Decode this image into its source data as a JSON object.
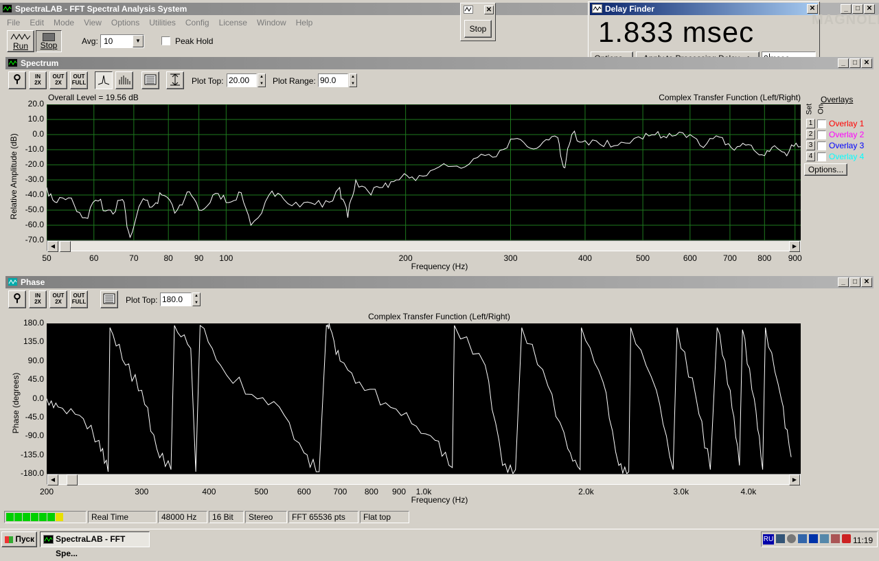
{
  "app": {
    "title": "SpectraLAB - FFT Spectral Analysis System",
    "menu": [
      "File",
      "Edit",
      "Mode",
      "View",
      "Options",
      "Utilities",
      "Config",
      "License",
      "Window",
      "Help"
    ],
    "run_label": "Run",
    "stop_label": "Stop",
    "avg_label": "Avg:",
    "avg_value": "10",
    "peak_hold_label": "Peak Hold"
  },
  "stop_popup": {
    "stop_label": "Stop"
  },
  "delay_finder": {
    "title": "Delay Finder",
    "value": "1.833 msec",
    "options_label": "Options...",
    "apply_label": "Apply to Processing Delay -->",
    "input_value": "0",
    "unit": "msec",
    "watermark": "MAGNOLIA"
  },
  "spectrum": {
    "title": "Spectrum",
    "plot_top_label": "Plot Top:",
    "plot_top_value": "20.00",
    "plot_range_label": "Plot Range:",
    "plot_range_value": "90.0",
    "overall_level": "Overall Level = 19.56 dB",
    "caption": "Complex Transfer Function (Left/Right)",
    "ylabel": "Relative Amplitude (dB)",
    "xlabel": "Frequency (Hz)",
    "yticks": [
      "20.0",
      "10.0",
      "0.0",
      "-10.0",
      "-20.0",
      "-30.0",
      "-40.0",
      "-50.0",
      "-60.0",
      "-70.0"
    ],
    "xticks": [
      "50",
      "60",
      "70",
      "80",
      "90",
      "100",
      "200",
      "300",
      "400",
      "500",
      "600",
      "700",
      "800",
      "900"
    ],
    "overlays": {
      "header": "Overlays",
      "set_label": "Set",
      "on_label": "On",
      "items": [
        {
          "num": "1",
          "label": "Overlay 1",
          "color": "#ff0000"
        },
        {
          "num": "2",
          "label": "Overlay 2",
          "color": "#ff00ff"
        },
        {
          "num": "3",
          "label": "Overlay 3",
          "color": "#0000ff"
        },
        {
          "num": "4",
          "label": "Overlay 4",
          "color": "#00ffff"
        }
      ],
      "options_label": "Options..."
    }
  },
  "phase": {
    "title": "Phase",
    "plot_top_label": "Plot Top:",
    "plot_top_value": "180.0",
    "caption": "Complex Transfer Function (Left/Right)",
    "ylabel": "Phase (degrees)",
    "xlabel": "Frequency (Hz)",
    "yticks": [
      "180.0",
      "135.0",
      "90.0",
      "45.0",
      "0.0",
      "-45.0",
      "-90.0",
      "-135.0",
      "-180.0"
    ],
    "xticks": [
      "200",
      "300",
      "400",
      "500",
      "600",
      "700",
      "800",
      "900",
      "1.0k",
      "2.0k",
      "3.0k",
      "4.0k"
    ]
  },
  "status": {
    "mode": "Real Time",
    "rate": "48000 Hz",
    "bits": "16 Bit",
    "channels": "Stereo",
    "fft": "FFT 65536 pts",
    "window": "Flat top"
  },
  "taskbar": {
    "start_label": "Пуск",
    "task_label": "SpectraLAB - FFT Spe...",
    "lang": "RU",
    "clock": "11:19"
  },
  "chart_data": [
    {
      "type": "line",
      "title": "Complex Transfer Function (Left/Right)",
      "xlabel": "Frequency (Hz)",
      "ylabel": "Relative Amplitude (dB)",
      "x_scale": "log",
      "xlim": [
        50,
        920
      ],
      "ylim": [
        -70,
        20
      ],
      "grid": true,
      "series": [
        {
          "x": [
            50,
            52,
            55,
            58,
            61,
            64,
            67,
            69,
            72,
            75,
            78,
            82,
            86,
            90,
            95,
            100,
            105,
            110,
            118,
            125,
            135,
            145,
            155,
            160,
            165,
            175,
            185,
            195,
            205,
            220,
            240,
            260,
            280,
            300,
            320,
            340,
            360,
            370,
            380,
            400,
            430,
            460,
            500,
            530,
            560,
            600,
            640,
            680,
            720,
            760,
            800,
            840,
            880,
            920
          ],
          "values": [
            -35,
            -45,
            -42,
            -55,
            -44,
            -50,
            -43,
            -68,
            -45,
            -48,
            -40,
            -52,
            -38,
            -50,
            -40,
            -45,
            -38,
            -60,
            -40,
            -43,
            -45,
            -48,
            -35,
            -55,
            -30,
            -40,
            -32,
            -30,
            -28,
            -24,
            -21,
            -16,
            -15,
            -3,
            -8,
            -5,
            -2,
            -22,
            0,
            -4,
            -8,
            -5,
            -3,
            2,
            -1,
            0,
            -6,
            -2,
            -8,
            -7,
            -14,
            -9,
            -11,
            -8
          ]
        }
      ]
    },
    {
      "type": "line",
      "title": "Complex Transfer Function (Left/Right)",
      "xlabel": "Frequency (Hz)",
      "ylabel": "Phase (degrees)",
      "x_scale": "log",
      "xlim": [
        200,
        5000
      ],
      "ylim": [
        -180,
        180
      ],
      "grid": false,
      "series": [
        {
          "x": [
            200,
            210,
            230,
            250,
            260,
            262,
            280,
            300,
            320,
            340,
            345,
            370,
            378,
            385,
            420,
            480,
            540,
            600,
            640,
            660,
            670,
            700,
            760,
            850,
            950,
            1050,
            1130,
            1140,
            1300,
            1400,
            1480,
            1520,
            1700,
            1850,
            1950,
            1960,
            2150,
            2300,
            2400,
            2420,
            2700,
            2900,
            2950,
            3200,
            3400,
            3500,
            3700,
            3850,
            3900,
            4100,
            4250,
            4300,
            4600,
            4800
          ],
          "values": [
            0,
            -20,
            -40,
            -100,
            -175,
            170,
            80,
            20,
            -120,
            -170,
            175,
            120,
            -175,
            175,
            80,
            10,
            -20,
            -130,
            -175,
            175,
            170,
            90,
            40,
            -10,
            -60,
            -100,
            -165,
            175,
            80,
            -160,
            -170,
            170,
            30,
            -120,
            -170,
            170,
            40,
            -160,
            -175,
            170,
            20,
            -170,
            170,
            0,
            -170,
            170,
            20,
            -160,
            165,
            0,
            -170,
            170,
            0,
            -140
          ]
        }
      ]
    }
  ]
}
